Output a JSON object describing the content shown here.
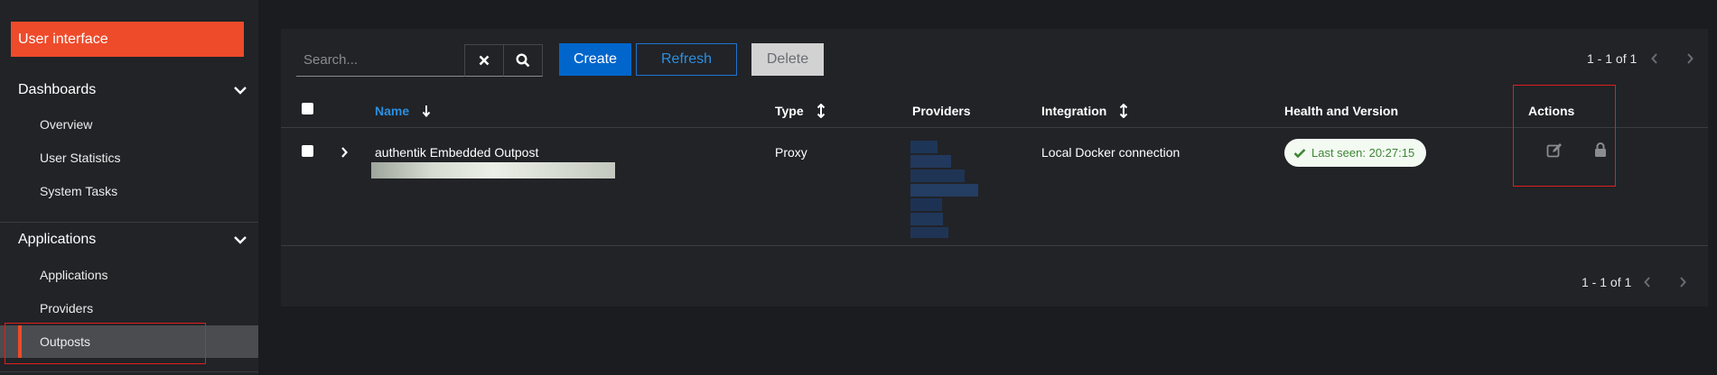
{
  "sidebar": {
    "header_button": "User interface",
    "sections": [
      {
        "label": "Dashboards",
        "items": [
          "Overview",
          "User Statistics",
          "System Tasks"
        ]
      },
      {
        "label": "Applications",
        "items": [
          "Applications",
          "Providers",
          "Outposts"
        ]
      }
    ],
    "active_item": "Outposts"
  },
  "toolbar": {
    "search_placeholder": "Search...",
    "create_label": "Create",
    "refresh_label": "Refresh",
    "delete_label": "Delete",
    "pagination_top": "1 - 1 of 1",
    "pagination_bottom": "1 - 1 of 1"
  },
  "table": {
    "columns": [
      "Name",
      "Type",
      "Providers",
      "Integration",
      "Health and Version",
      "Actions"
    ],
    "rows": [
      {
        "name": "authentik Embedded Outpost",
        "type": "Proxy",
        "integration": "Local Docker connection",
        "health": "Last seen: 20:27:15"
      }
    ]
  },
  "colors": {
    "accent": "#ee4b2b",
    "primary": "#0066cc",
    "success": "#3e8635"
  }
}
